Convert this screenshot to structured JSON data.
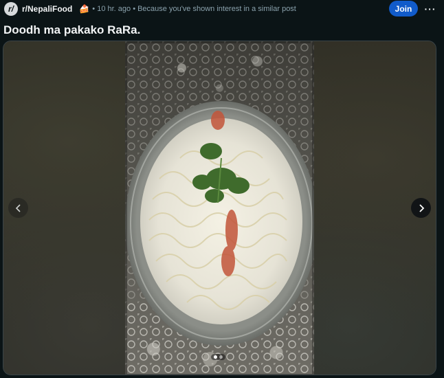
{
  "header": {
    "subreddit_avatar": "r/",
    "subreddit": "r/NepaliFood",
    "flair_icon": "🍰",
    "time_meta": "• 10 hr. ago • Because you've shown interest in a similar post",
    "join_label": "Join",
    "more_label": "···"
  },
  "post": {
    "title": "Doodh ma pakako RaRa."
  },
  "gallery": {
    "image_count": 2,
    "current_index": 0
  },
  "colors": {
    "background": "#0b1416",
    "join_button": "#115bca",
    "meta_text": "#8ba2ad"
  }
}
